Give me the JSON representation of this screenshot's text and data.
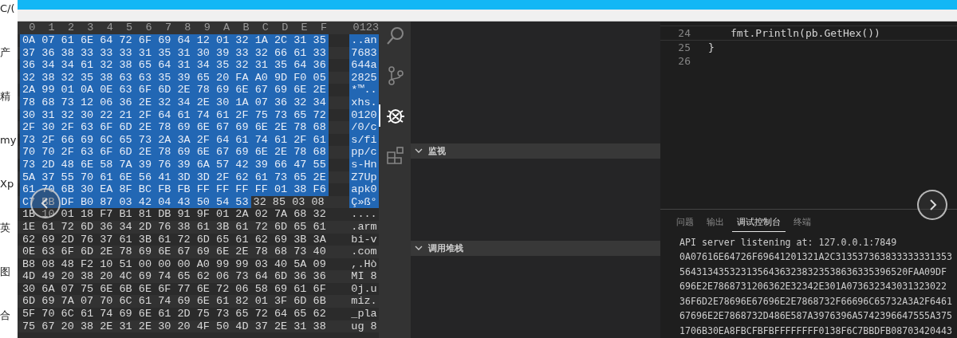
{
  "background_window": {
    "fragments": [
      "C/(",
      "产",
      "精",
      "my",
      "Xp",
      "英",
      "图",
      "合"
    ]
  },
  "hex_editor": {
    "columns": [
      "0",
      "1",
      "2",
      "3",
      "4",
      "5",
      "6",
      "7",
      "8",
      "9",
      "A",
      "B",
      "C",
      "D",
      "E",
      "F"
    ],
    "ascii_header": "0123",
    "rows": [
      {
        "segments": [
          {
            "hex": "0A 07 61 6E 64 72 6F 69 64 12 01 32 1A 2C 31 35",
            "selected": true
          }
        ],
        "ascii": {
          "text": "..an",
          "selected": true
        }
      },
      {
        "segments": [
          {
            "hex": "37 36 38 33 33 33 31 35 31 30 39 33 32 66 61 33",
            "selected": true
          }
        ],
        "ascii": {
          "text": "7683",
          "selected": true
        }
      },
      {
        "segments": [
          {
            "hex": "36 34 34 61 32 38 65 64 31 34 35 32 31 35 64 36",
            "selected": true
          }
        ],
        "ascii": {
          "text": "644a",
          "selected": true
        }
      },
      {
        "segments": [
          {
            "hex": "32 38 32 35 38 63 63 35 39 65 20 FA A0 9D F0 05",
            "selected": true
          }
        ],
        "ascii": {
          "text": "2825",
          "selected": true
        }
      },
      {
        "segments": [
          {
            "hex": "2A 99 01 0A 0E 63 6F 6D 2E 78 69 6E 67 69 6E 2E",
            "selected": true
          }
        ],
        "ascii": {
          "text": "*™..",
          "selected": true
        }
      },
      {
        "segments": [
          {
            "hex": "78 68 73 12 06 36 2E 32 34 2E 30 1A 07 36 32 34",
            "selected": true
          }
        ],
        "ascii": {
          "text": "xhs.",
          "selected": true
        }
      },
      {
        "segments": [
          {
            "hex": "30 31 32 30 22 21 2F 64 61 74 61 2F 75 73 65 72",
            "selected": true
          }
        ],
        "ascii": {
          "text": "0120",
          "selected": true
        }
      },
      {
        "segments": [
          {
            "hex": "2F 30 2F 63 6F 6D 2E 78 69 6E 67 69 6E 2E 78 68",
            "selected": true
          }
        ],
        "ascii": {
          "text": "/0/c",
          "selected": true
        }
      },
      {
        "segments": [
          {
            "hex": "73 2F 66 69 6C 65 73 2A 3A 2F 64 61 74 61 2F 61",
            "selected": true
          }
        ],
        "ascii": {
          "text": "s/fi",
          "selected": true
        }
      },
      {
        "segments": [
          {
            "hex": "70 70 2F 63 6F 6D 2E 78 69 6E 67 69 6E 2E 78 68",
            "selected": true
          }
        ],
        "ascii": {
          "text": "pp/c",
          "selected": true
        }
      },
      {
        "segments": [
          {
            "hex": "73 2D 48 6E 58 7A 39 76 39 6A 57 42 39 66 47 55",
            "selected": true
          }
        ],
        "ascii": {
          "text": "s-Hn",
          "selected": true
        }
      },
      {
        "segments": [
          {
            "hex": "5A 37 55 70 61 6E 56 41 3D 3D 2F 62 61 73 65 2E",
            "selected": true
          }
        ],
        "ascii": {
          "text": "Z7Up",
          "selected": true
        }
      },
      {
        "segments": [
          {
            "hex": "61 70 6B 30 EA 8F BC FB FB FF FF FF FF 01 38 F6",
            "selected": true
          }
        ],
        "ascii": {
          "text": "apk0",
          "selected": true
        }
      },
      {
        "segments": [
          {
            "hex": "C7 BB DF B0 87 03 42 04 43 50 54 53",
            "selected": true
          },
          {
            "hex": "32 85 03 08",
            "selected": false
          }
        ],
        "ascii": {
          "text": "Ç»ß°",
          "selected": true
        }
      },
      {
        "segments": [
          {
            "hex": "1B 10 01 18 F7 B1 81 DB 91 9F 01 2A 02 7A 68 32",
            "selected": false
          }
        ],
        "ascii": {
          "text": "....",
          "selected": false
        }
      },
      {
        "segments": [
          {
            "hex": "1E 61 72 6D 36 34 2D 76 38 61 3B 61 72 6D 65 61",
            "selected": false
          }
        ],
        "ascii": {
          "text": ".arm",
          "selected": false
        }
      },
      {
        "segments": [
          {
            "hex": "62 69 2D 76 37 61 3B 61 72 6D 65 61 62 69 3B 3A",
            "selected": false
          }
        ],
        "ascii": {
          "text": "bi-v",
          "selected": false
        }
      },
      {
        "segments": [
          {
            "hex": "0E 63 6F 6D 2E 78 69 6E 67 69 6E 2E 78 68 73 40",
            "selected": false
          }
        ],
        "ascii": {
          "text": ".com",
          "selected": false
        }
      },
      {
        "segments": [
          {
            "hex": "B8 08 48 F2 10 51 00 00 00 A0 99 99 03 40 5A 09",
            "selected": false
          }
        ],
        "ascii": {
          "text": ",.Hò",
          "selected": false
        }
      },
      {
        "segments": [
          {
            "hex": "4D 49 20 38 20 4C 69 74 65 62 06 73 64 6D 36 36",
            "selected": false
          }
        ],
        "ascii": {
          "text": "MI 8",
          "selected": false
        }
      },
      {
        "segments": [
          {
            "hex": "30 6A 07 75 6E 6B 6E 6F 77 6E 72 06 58 69 61 6F",
            "selected": false
          }
        ],
        "ascii": {
          "text": "0j.u",
          "selected": false
        }
      },
      {
        "segments": [
          {
            "hex": "6D 69 7A 07 70 6C 61 74 69 6E 61 82 01 3F 6D 6B",
            "selected": false
          }
        ],
        "ascii": {
          "text": "miz.",
          "selected": false
        }
      },
      {
        "segments": [
          {
            "hex": "5F 70 6C 61 74 69 6E 61 2D 75 73 65 72 64 65 62",
            "selected": false
          }
        ],
        "ascii": {
          "text": "_pla",
          "selected": false
        }
      },
      {
        "segments": [
          {
            "hex": "75 67 20 38 2E 31 2E 30 20 4F 50 4D 37 2E 31 38",
            "selected": false
          }
        ],
        "ascii": {
          "text": "ug 8",
          "selected": false
        }
      }
    ]
  },
  "activity_bar": [
    {
      "kind": "search",
      "selected": false
    },
    {
      "kind": "source-control",
      "selected": false
    },
    {
      "kind": "debug",
      "selected": true
    },
    {
      "kind": "extensions",
      "selected": false
    }
  ],
  "sidebar": {
    "sections": [
      {
        "title": "监视",
        "expanded": true
      },
      {
        "title": "调用堆栈",
        "expanded": true
      }
    ]
  },
  "editor": {
    "lines": [
      {
        "number": "24",
        "code": "fmt.Println(pb.GetHex())",
        "indent": true
      },
      {
        "number": "25",
        "code": "}",
        "indent": false
      },
      {
        "number": "26"
      }
    ]
  },
  "panel": {
    "tabs": [
      {
        "label": "问题",
        "selected": false
      },
      {
        "label": "输出",
        "selected": false
      },
      {
        "label": "调试控制台",
        "selected": true
      },
      {
        "label": "终端",
        "selected": false
      }
    ],
    "console": [
      "API server listening at: 127.0.0.1:7849",
      "0A07616E64726F69641201321A2C313537363833333331353",
      "56431343532313564363238323538636335396520FAA09DF",
      "696E2E7868731206362E32342E301A073632343031323022",
      "36F6D2E78696E67696E2E7868732F66696C65732A3A2F6461",
      "67696E2E7868732D486E587A3976396A5742396647555A375",
      "1706B30EA8FBCFBFBFFFFFFFF0138F6C7BBDFB08703420443"
    ]
  }
}
